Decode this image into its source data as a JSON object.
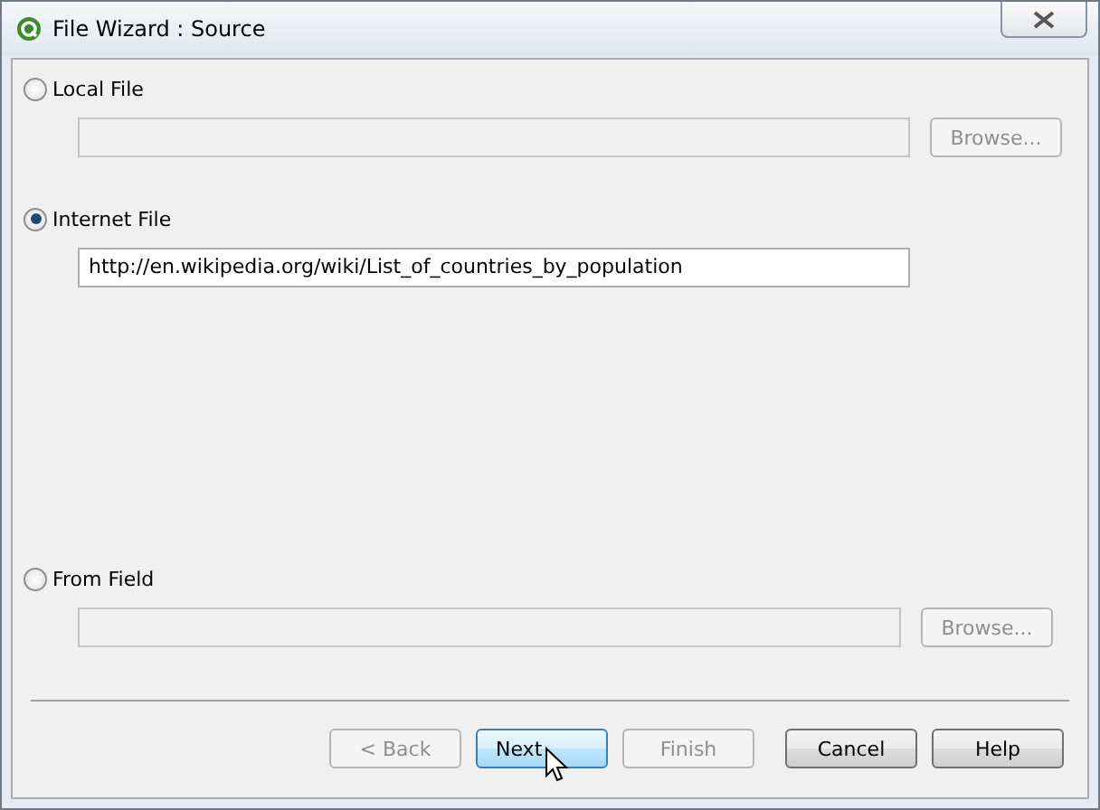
{
  "window": {
    "title": "File Wizard : Source"
  },
  "sources": [
    {
      "label": "Local File",
      "selected": false,
      "field": {
        "disabled": true
      },
      "browse": {
        "label": "Browse...",
        "disabled": true
      }
    },
    {
      "label": "Internet File",
      "selected": true,
      "field": {
        "value": "http://en.wikipedia.org/wiki/List_of_countries_by_population",
        "disabled": false
      }
    },
    {
      "label": "From Field",
      "selected": false,
      "field": {
        "disabled": true
      },
      "browse": {
        "label": "Browse...",
        "disabled": true
      }
    }
  ],
  "buttons": [
    {
      "label": "< Back",
      "disabled": true,
      "highlighted": false
    },
    {
      "label": "Next",
      "disabled": false,
      "highlighted": true
    },
    {
      "label": "Finish",
      "disabled": true,
      "highlighted": false
    },
    {
      "label": "Cancel",
      "disabled": false,
      "highlighted": false
    },
    {
      "label": "Help",
      "disabled": false,
      "highlighted": false
    }
  ]
}
